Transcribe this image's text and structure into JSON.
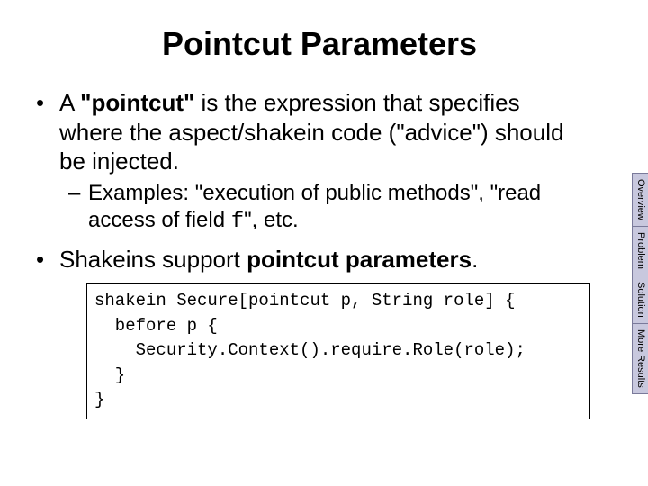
{
  "title": "Pointcut Parameters",
  "bullets": {
    "b1_pre": "A ",
    "b1_bold": "\"pointcut\"",
    "b1_post": " is the expression that specifies where the aspect/shakein code (\"advice\") should be injected.",
    "sub_pre": "Examples: \"execution of public methods\", \"read access of field ",
    "sub_mono": "f",
    "sub_post": "\", etc.",
    "b2_pre": "Shakeins support ",
    "b2_bold": "pointcut parameters",
    "b2_post": "."
  },
  "code": "shakein Secure[pointcut p, String role] {\n  before p {\n    Security.Context().require.Role(role);\n  }\n}",
  "tabs": [
    "Overview",
    "Problem",
    "Solution",
    "More Results"
  ]
}
